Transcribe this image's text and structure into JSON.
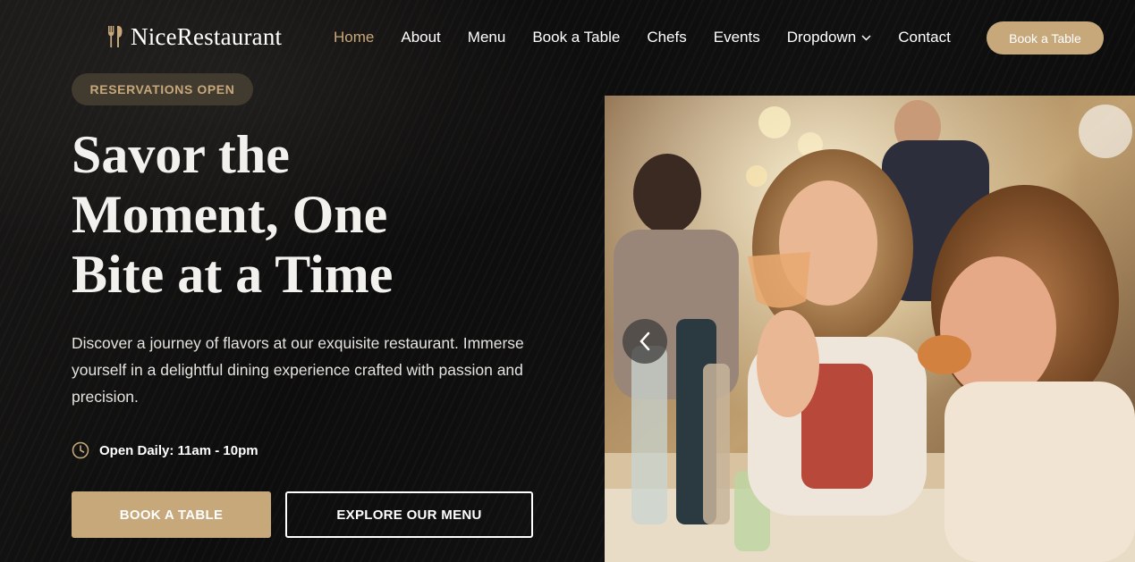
{
  "brand": {
    "name": "NiceRestaurant",
    "icon": "fork-knife-icon",
    "accent_color": "#c6a87b"
  },
  "nav": {
    "items": [
      {
        "label": "Home",
        "active": true
      },
      {
        "label": "About"
      },
      {
        "label": "Menu"
      },
      {
        "label": "Book a Table"
      },
      {
        "label": "Chefs"
      },
      {
        "label": "Events"
      },
      {
        "label": "Dropdown",
        "icon": "chevron-down-icon"
      },
      {
        "label": "Contact"
      }
    ],
    "cta_label": "Book a Table"
  },
  "hero": {
    "badge": "RESERVATIONS OPEN",
    "title_lines": [
      "Savor the",
      "Moment, One",
      "Bite at a Time"
    ],
    "description": "Discover a journey of flavors at our exquisite restaurant. Immerse yourself in a delightful dining experience crafted with passion and precision.",
    "hours_icon": "clock-icon",
    "hours": "Open Daily: 11am - 10pm",
    "primary_button": "BOOK A TABLE",
    "secondary_button": "EXPLORE OUR MENU"
  },
  "carousel": {
    "prev_icon": "chevron-left-icon",
    "image_subject": "restaurant-diners-photo"
  }
}
